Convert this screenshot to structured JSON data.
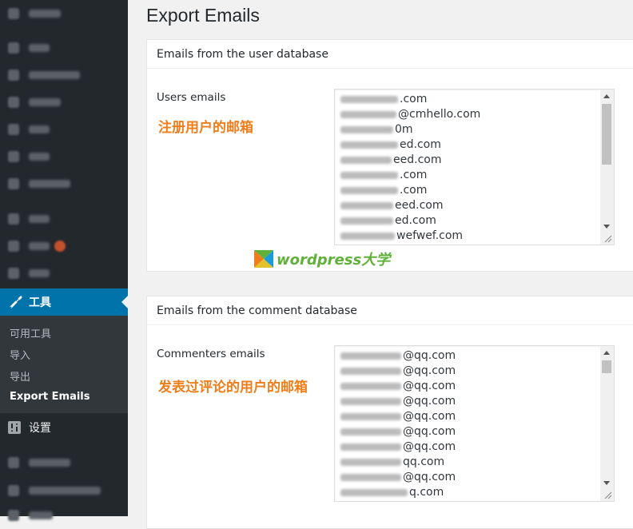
{
  "sidebar": {
    "active_label": "工具",
    "submenu": [
      "可用工具",
      "导入",
      "导出",
      "Export Emails"
    ],
    "settings_label": "设置"
  },
  "page": {
    "title": "Export Emails"
  },
  "user_box": {
    "heading": "Emails from the user database",
    "label": "Users emails",
    "annotation": "注册用户的邮箱",
    "emails": [
      ".com",
      "@cmhello.com",
      "0m",
      "ed.com",
      "eed.com",
      ".com",
      ".com",
      "eed.com",
      "ed.com",
      "wefwef.com"
    ]
  },
  "comment_box": {
    "heading": "Emails from the comment database",
    "label": "Commenters emails",
    "annotation": "发表过评论的用户的邮箱",
    "emails": [
      "@qq.com",
      "@qq.com",
      "@qq.com",
      "@qq.com",
      "@qq.com",
      "@qq.com",
      "@qq.com",
      "qq.com",
      "@qq.com",
      "q.com"
    ]
  },
  "watermark": {
    "text": "wordpress大学"
  }
}
